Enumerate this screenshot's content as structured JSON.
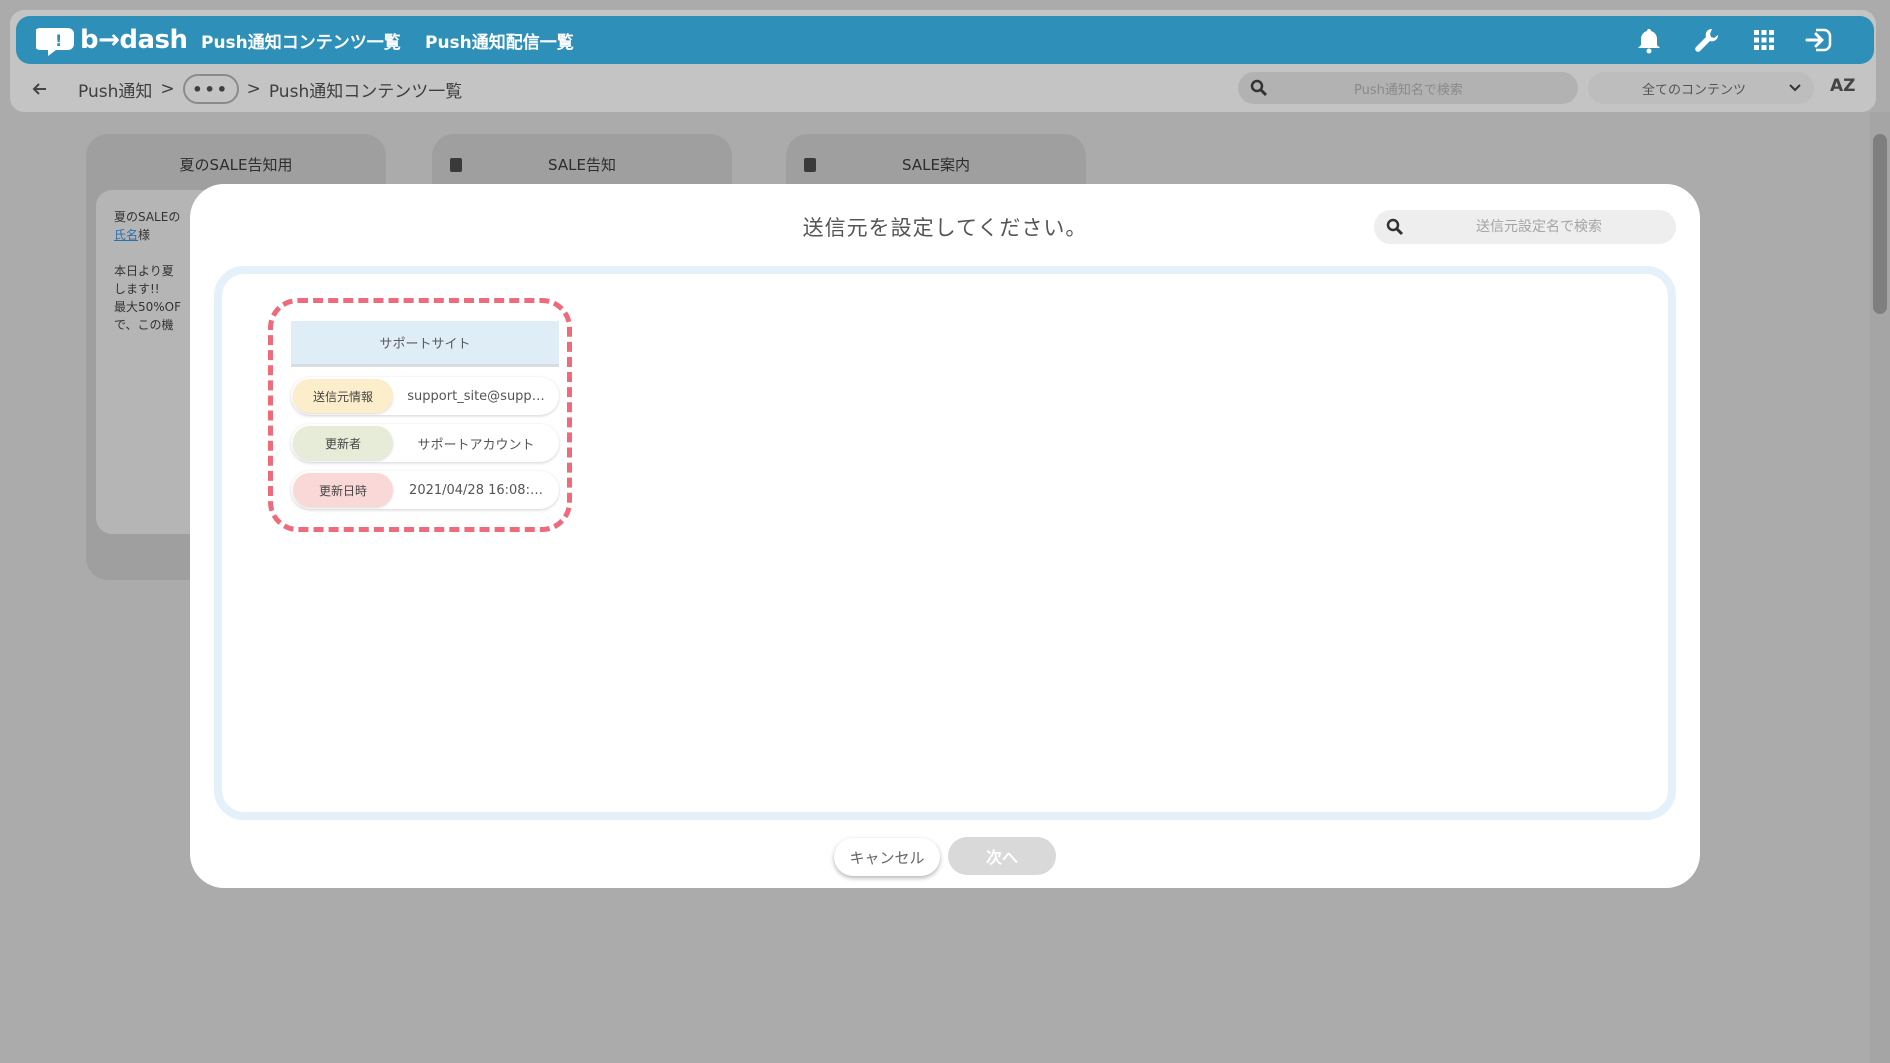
{
  "app": {
    "logo_text": "b→dash",
    "nav": [
      "Push通知コンテンツ一覧",
      "Push通知配信一覧"
    ]
  },
  "breadcrumb": {
    "root": "Push通知",
    "sep": ">",
    "dots": "•••",
    "current": "Push通知コンテンツ一覧"
  },
  "top_search": {
    "placeholder": "Push通知名で検索"
  },
  "top_filter": {
    "selected": "全てのコンテンツ"
  },
  "sort_label": "AZ",
  "background_cards": [
    {
      "title": "夏のSALE告知用",
      "lines": [
        "夏のSALEの",
        "氏名様",
        "",
        "本日より夏",
        "します!!",
        "最大50%OF",
        "で、この機"
      ]
    },
    {
      "title": "SALE告知"
    },
    {
      "title": "SALE案内"
    }
  ],
  "modal": {
    "title": "送信元を設定してください。",
    "search_placeholder": "送信元設定名で検索",
    "cancel_label": "キャンセル",
    "next_label": "次へ",
    "sender_cards": [
      {
        "name": "サポートサイト",
        "rows": [
          {
            "label": "送信元情報",
            "value": "support_site@supp…"
          },
          {
            "label": "更新者",
            "value": "サポートアカウント"
          },
          {
            "label": "更新日時",
            "value": "2021/04/28 16:08:…"
          }
        ]
      }
    ]
  },
  "colors": {
    "nav": "#2e8fb8",
    "card_border": "#ef6a7a",
    "label_sender": "#fdeecb",
    "label_updater": "#e6ecd8",
    "label_date": "#fbd8d8"
  }
}
